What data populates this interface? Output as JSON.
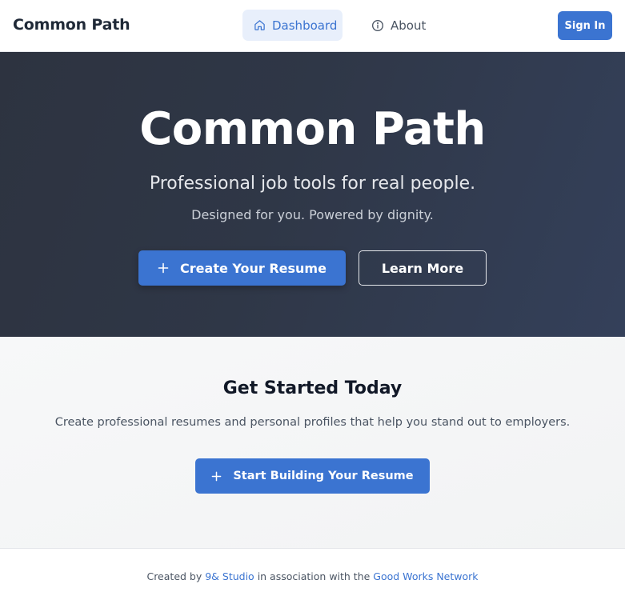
{
  "header": {
    "brand": "Common Path",
    "nav": [
      {
        "label": "Dashboard",
        "icon": "home-icon",
        "active": true
      },
      {
        "label": "About",
        "icon": "info-icon",
        "active": false
      }
    ],
    "sign_in_label": "Sign In"
  },
  "hero": {
    "title": "Common Path",
    "subtitle": "Professional job tools for real people.",
    "tagline": "Designed for you. Powered by dignity.",
    "primary_button": {
      "label": "Create Your Resume",
      "icon": "plus-icon"
    },
    "secondary_button": {
      "label": "Learn More"
    }
  },
  "get_started": {
    "title": "Get Started Today",
    "text": "Create professional resumes and personal profiles that help you stand out to employers.",
    "button": {
      "label": "Start Building Your Resume",
      "icon": "plus-icon"
    }
  },
  "footer": {
    "prefix": "Created by ",
    "studio_link": "9& Studio",
    "middle": " in association with the ",
    "network_link": "Good Works Network"
  },
  "colors": {
    "accent": "#3b74d1",
    "hero_bg": "#2f3747",
    "active_nav_bg": "#e8effb"
  }
}
